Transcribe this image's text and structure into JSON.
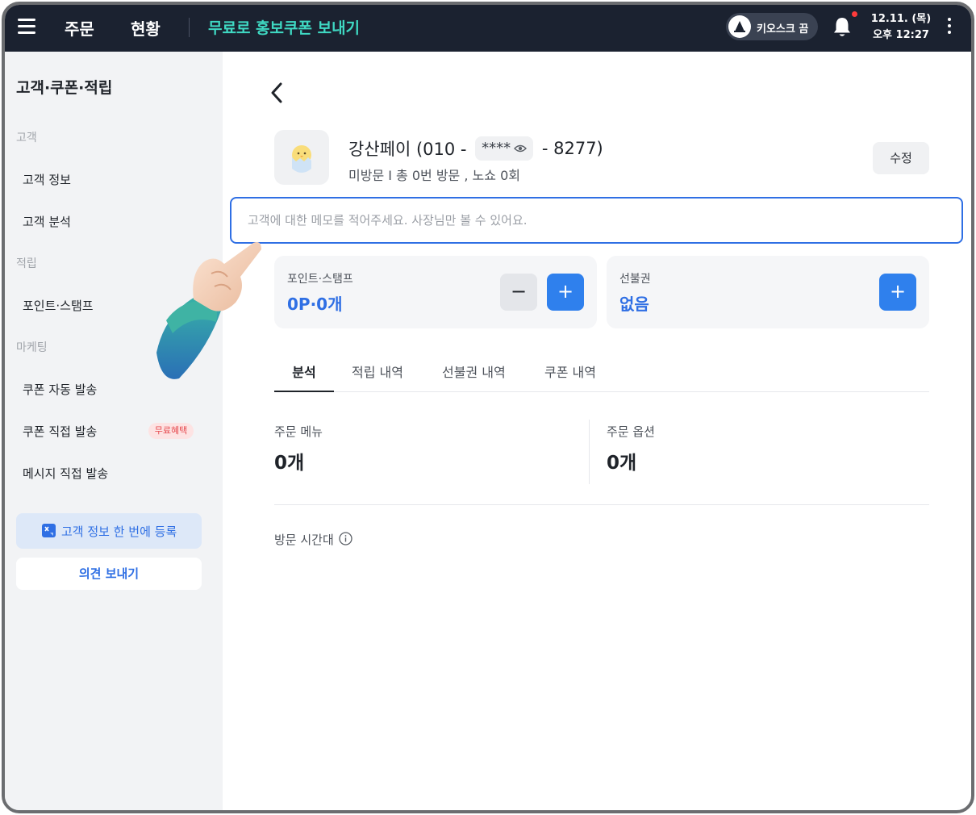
{
  "topbar": {
    "nav": [
      "주문",
      "현황"
    ],
    "promo_link": "무료로 홍보쿠폰 보내기",
    "kiosk_label": "키오스크 끔",
    "date": "12.11. (목)",
    "time": "오후 12:27",
    "promo_color": "#3fd9c3",
    "background": "#1b2230"
  },
  "sidebar": {
    "title": "고객·쿠폰·적립",
    "sections": [
      {
        "label": "고객",
        "items": [
          "고객 정보",
          "고객 분석"
        ]
      },
      {
        "label": "적립",
        "items": [
          "포인트·스탬프"
        ]
      },
      {
        "label": "마케팅",
        "items": [
          "쿠폰 자동 발송",
          "쿠폰 직접 발송",
          "메시지 직접 발송"
        ]
      }
    ],
    "free_badge": "무료혜택",
    "bulk_register": "고객 정보 한 번에 등록",
    "feedback": "의견 보내기"
  },
  "customer": {
    "name_prefix": "강산페이 (010 -",
    "masked": "****",
    "name_suffix": "- 8277)",
    "summary": "미방문 I 총 0번 방문 , 노쇼 0회",
    "edit": "수정"
  },
  "memo": {
    "placeholder": "고객에 대한 메모를 적어주세요. 사장님만 볼 수 있어요.",
    "value": ""
  },
  "cards": {
    "points": {
      "label": "포인트·스탬프",
      "value": "0P·0개",
      "minus": "−",
      "plus": "+"
    },
    "prepaid": {
      "label": "선불권",
      "value": "없음",
      "plus": "+"
    }
  },
  "tabs": [
    "분석",
    "적립 내역",
    "선불권 내역",
    "쿠폰 내역"
  ],
  "active_tab": "분석",
  "stats": [
    {
      "label": "주문 메뉴",
      "value": "0개"
    },
    {
      "label": "주문 옵션",
      "value": "0개"
    }
  ],
  "visit_time_label": "방문 시간대",
  "accent_color": "#2f6fe4",
  "icons": [
    "menu-icon",
    "kiosk-icon",
    "bell-icon",
    "more-vertical-icon",
    "back-arrow-icon",
    "eye-icon",
    "excel-icon",
    "info-icon",
    "pointing-hand-icon"
  ]
}
